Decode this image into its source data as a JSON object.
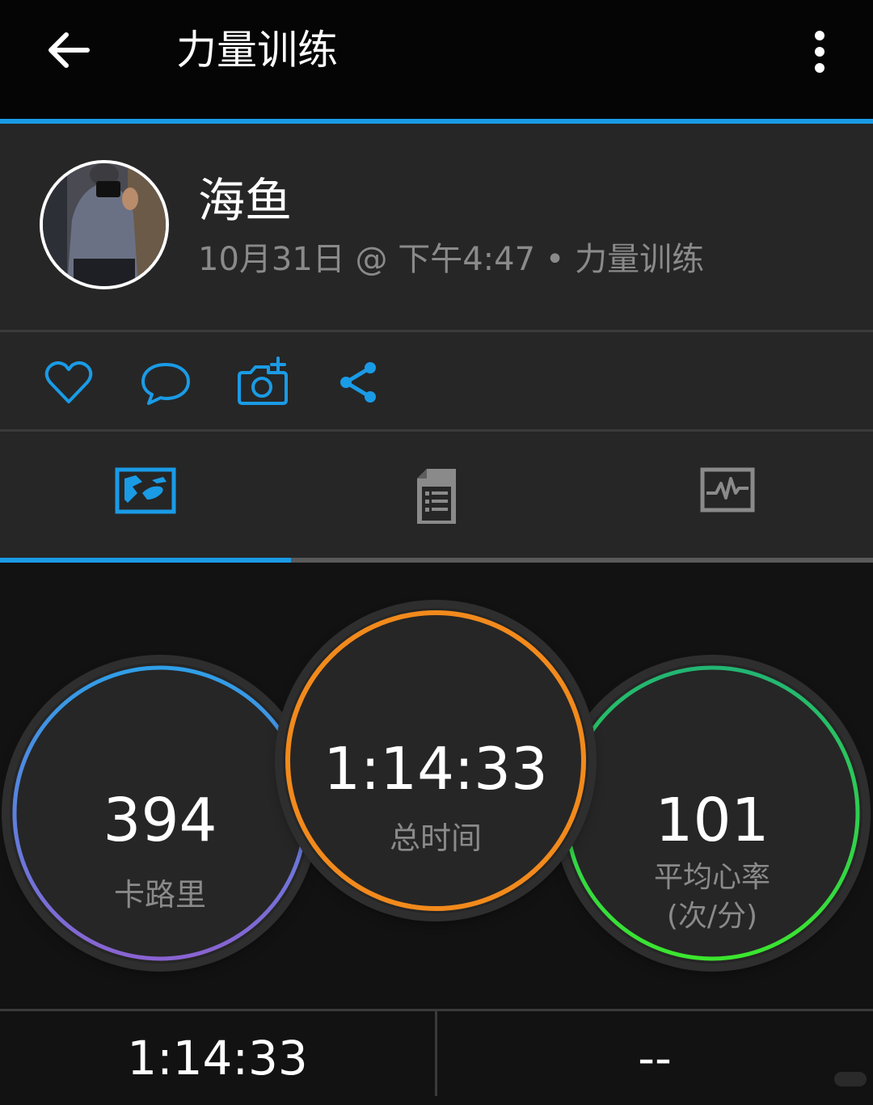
{
  "header": {
    "title": "力量训练",
    "back_icon": "arrow-left-icon",
    "more_icon": "more-vertical-icon"
  },
  "profile": {
    "name": "海鱼",
    "meta": "10月31日 @ 下午4:47 • 力量训练"
  },
  "actions": {
    "like_icon": "heart-icon",
    "comment_icon": "comment-icon",
    "photo_icon": "camera-add-icon",
    "share_icon": "share-icon"
  },
  "tabs": [
    {
      "icon": "map-overview-icon",
      "active": true
    },
    {
      "icon": "document-list-icon",
      "active": false
    },
    {
      "icon": "chart-heartbeat-icon",
      "active": false
    }
  ],
  "stats": {
    "calories": {
      "value": "394",
      "label": "卡路里"
    },
    "total_time": {
      "value": "1:14:33",
      "label": "总时间"
    },
    "avg_hr": {
      "value": "101",
      "label_line1": "平均心率",
      "label_line2": "(次/分)"
    }
  },
  "bottom": {
    "left_value": "1:14:33",
    "right_value": "--"
  },
  "colors": {
    "accent": "#1a9be6",
    "calories_ring_start": "#2f9fe8",
    "calories_ring_end": "#8a63d2",
    "time_ring": "#f28a1c",
    "hr_ring_start": "#22b573",
    "hr_ring_end": "#3be62e"
  }
}
